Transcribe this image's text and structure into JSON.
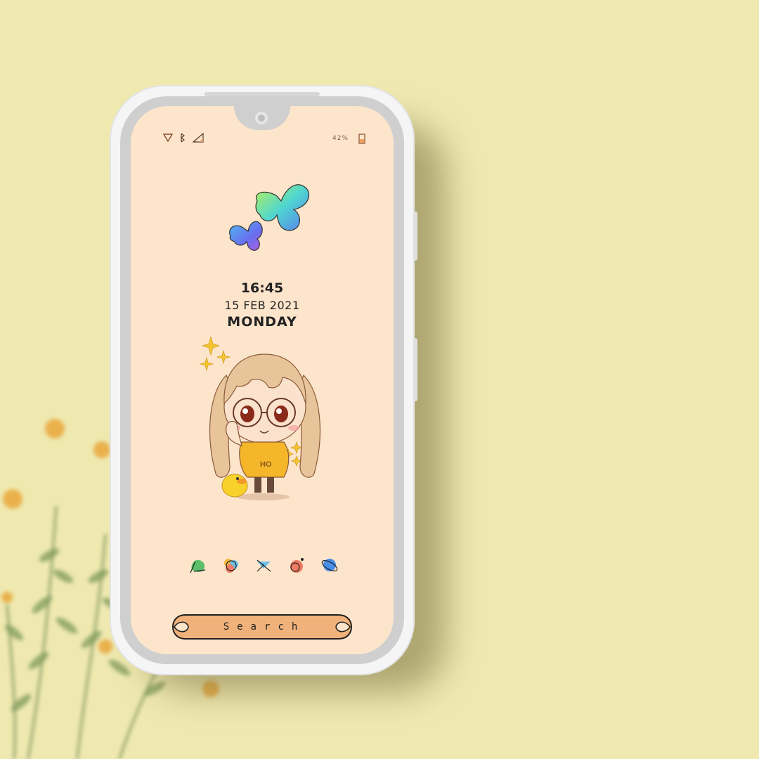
{
  "status_bar": {
    "left_icons": [
      "wifi-icon",
      "bluetooth-icon",
      "signal-icon"
    ],
    "battery_text": "42%",
    "battery_icon": "battery-icon"
  },
  "clock": {
    "time": "16:45",
    "date": "15 FEB 2021",
    "day": "MONDAY"
  },
  "dock": {
    "apps": [
      {
        "icon": "messages-icon",
        "color": "#5cbf6a"
      },
      {
        "icon": "photos-icon",
        "color": "#f2b640"
      },
      {
        "icon": "mail-icon",
        "color": "#6ec2e8"
      },
      {
        "icon": "camera-icon",
        "color": "#f07a63"
      },
      {
        "icon": "browser-icon",
        "color": "#4a8ee8"
      }
    ]
  },
  "search": {
    "label": "Search",
    "fill": "#f0b27a"
  },
  "wallpaper": {
    "shirt_text": "HO",
    "colors": {
      "background": "#efe9b0",
      "screen": "#fde5cb"
    }
  }
}
